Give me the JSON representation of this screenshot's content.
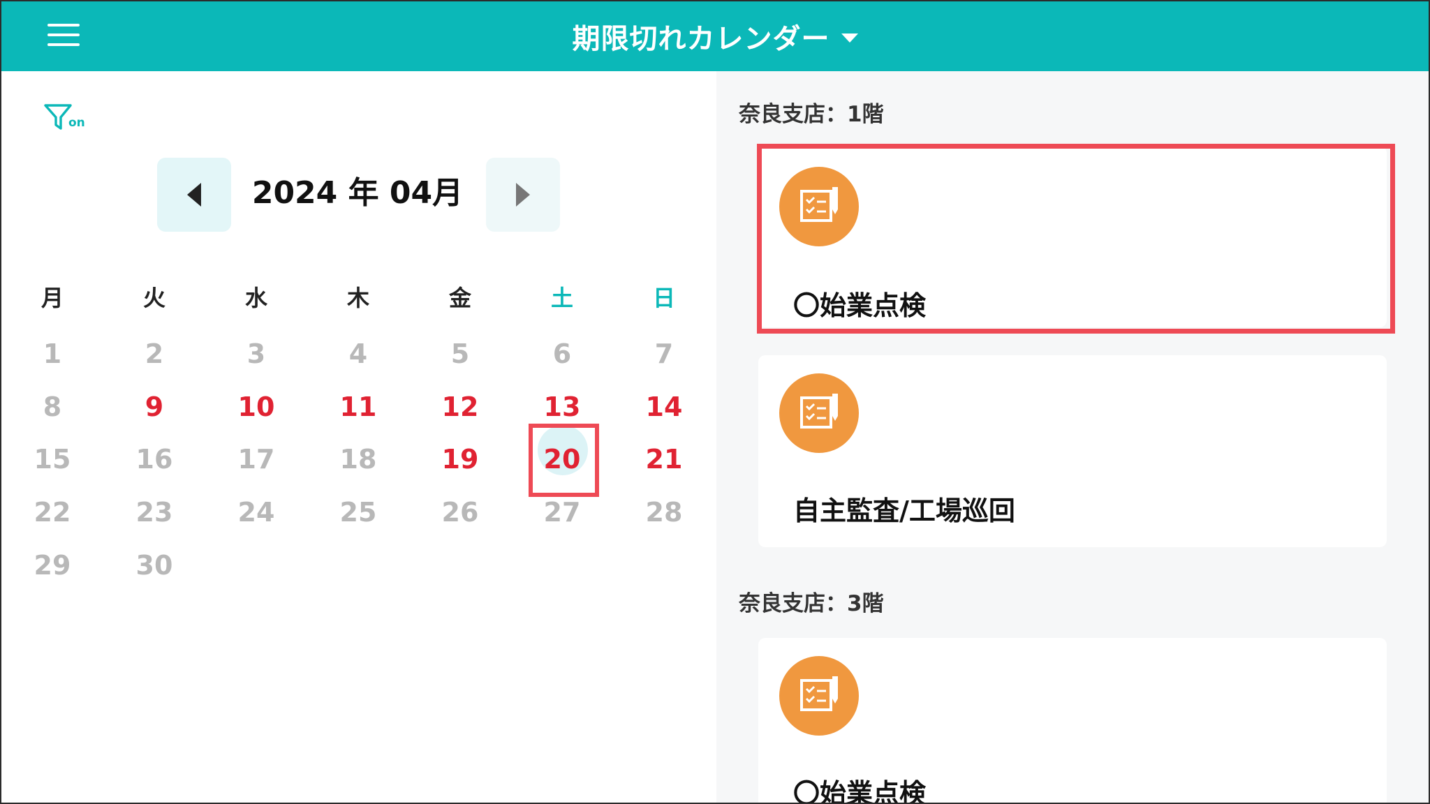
{
  "header": {
    "title": "期限切れカレンダー",
    "menu_icon": "hamburger-menu-icon",
    "dropdown_icon": "caret-down-icon",
    "color": "#0bb8b8"
  },
  "filter": {
    "icon": "filter-icon",
    "state": "on"
  },
  "calendar": {
    "month_label": "2024 年 04月",
    "prev_icon": "chevron-left-icon",
    "next_icon": "chevron-right-icon",
    "weekdays": [
      "月",
      "火",
      "水",
      "木",
      "金",
      "土",
      "日"
    ],
    "weeks": [
      [
        "1",
        "2",
        "3",
        "4",
        "5",
        "6",
        "7"
      ],
      [
        "8",
        "9",
        "10",
        "11",
        "12",
        "13",
        "14"
      ],
      [
        "15",
        "16",
        "17",
        "18",
        "19",
        "20",
        "21"
      ],
      [
        "22",
        "23",
        "24",
        "25",
        "26",
        "27",
        "28"
      ],
      [
        "29",
        "30"
      ]
    ],
    "overdue_days": [
      "9",
      "10",
      "11",
      "12",
      "13",
      "14",
      "19",
      "20",
      "21"
    ],
    "selected_day": "20",
    "overdue_color": "#e02232",
    "weekend_header_color": "#0bb8b8"
  },
  "sections": [
    {
      "label": "奈良支店：1階",
      "items": [
        {
          "title": "〇始業点検",
          "icon": "checklist-icon"
        },
        {
          "title": "自主監査/工場巡回",
          "icon": "checklist-icon"
        }
      ]
    },
    {
      "label": "奈良支店：3階",
      "items": [
        {
          "title": "〇始業点検",
          "icon": "checklist-icon"
        }
      ]
    }
  ],
  "icon_color": "#f0983f",
  "highlight_color": "#ee4a55"
}
